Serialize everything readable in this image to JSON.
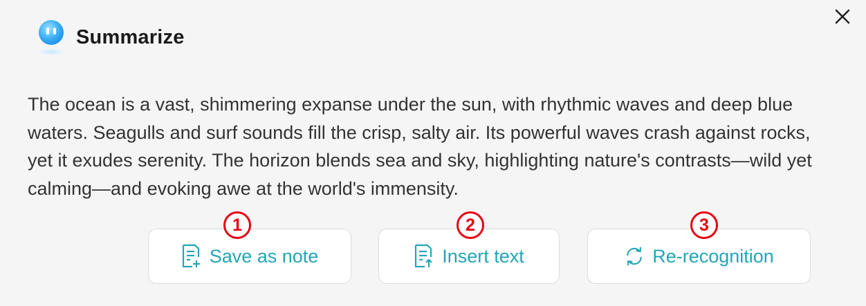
{
  "dialog": {
    "title": "Summarize",
    "close_icon": "close-icon",
    "logo_icon": "assistant-logo-icon"
  },
  "summary_text": "The ocean is a vast, shimmering expanse under the sun, with rhythmic waves and deep blue waters. Seagulls and surf sounds fill the crisp, salty air. Its powerful waves crash against rocks, yet it exudes serenity. The horizon blends sea and sky, highlighting nature's contrasts—wild yet calming—and evoking awe at the world's immensity.",
  "actions": [
    {
      "label": "Save as note",
      "icon": "note-add-icon",
      "marker": "1"
    },
    {
      "label": "Insert text",
      "icon": "note-insert-icon",
      "marker": "2"
    },
    {
      "label": "Re-recognition",
      "icon": "refresh-icon",
      "marker": "3"
    }
  ],
  "colors": {
    "accent": "#21a6b7",
    "marker": "#e60012",
    "background": "#f5f5f6",
    "text": "#333333"
  }
}
